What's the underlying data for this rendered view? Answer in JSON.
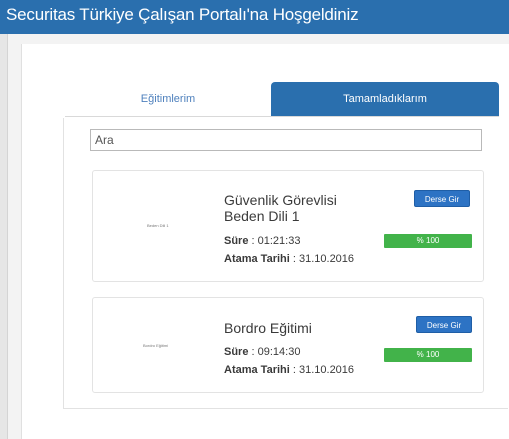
{
  "header": {
    "title": "Securitas Türkiye Çalışan Portalı'na Hoşgeldiniz"
  },
  "tabs": [
    {
      "label": "Eğitimlerim",
      "active": false
    },
    {
      "label": "Tamamladıklarım",
      "active": true
    }
  ],
  "search": {
    "value": "",
    "placeholder": "Ara"
  },
  "courses": [
    {
      "thumbnail_text": "Beden Dili 1",
      "title_line1": "Güvenlik Görevlisi",
      "title_line2": "Beden Dili 1",
      "duration_label": "Süre",
      "duration": "01:21:33",
      "assign_label": "Atama Tarihi",
      "assign_date": "31.10.2016",
      "button_label": "Derse Gir",
      "progress_text": "% 100",
      "progress": 1.0
    },
    {
      "thumbnail_text": "Bordro Eğitimi",
      "title_line1": "Bordro Eğitimi",
      "duration_label": "Süre",
      "duration": "09:14:30",
      "assign_label": "Atama Tarihi",
      "assign_date": "31.10.2016",
      "button_label": "Derse Gir",
      "progress_text": "% 100",
      "progress": 1.0
    }
  ],
  "colors": {
    "brand": "#2a6fae",
    "button": "#2d73c4",
    "progress": "#42b34a"
  }
}
